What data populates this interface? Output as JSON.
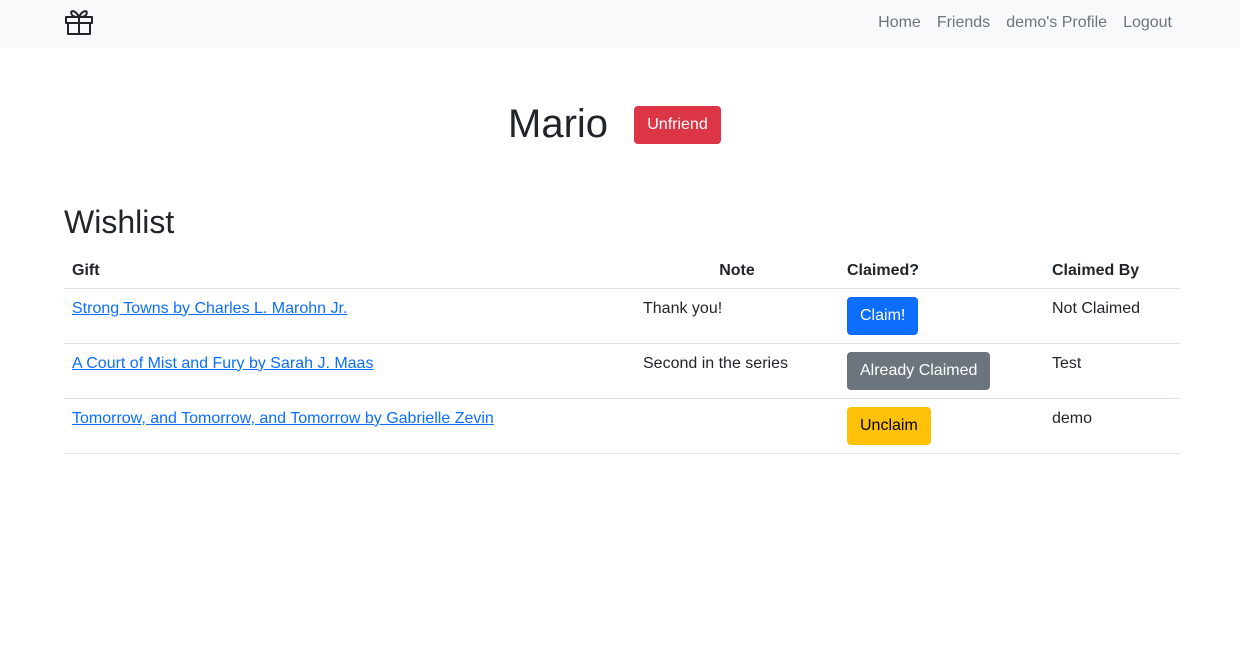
{
  "navbar": {
    "brand_icon": "gift-icon",
    "links": [
      "Home",
      "Friends",
      "demo's Profile",
      "Logout"
    ]
  },
  "profile": {
    "name": "Mario",
    "unfriend_label": "Unfriend"
  },
  "wishlist": {
    "title": "Wishlist",
    "columns": [
      "Gift",
      "Note",
      "Claimed?",
      "Claimed By"
    ],
    "rows": [
      {
        "gift": "Strong Towns by Charles L. Marohn Jr.",
        "note": "Thank you!",
        "action": "Claim!",
        "claimed_by": "Not Claimed"
      },
      {
        "gift": "A Court of Mist and Fury by Sarah J. Maas",
        "note": "Second in the series",
        "action": "Already Claimed",
        "claimed_by": "Test"
      },
      {
        "gift": "Tomorrow, and Tomorrow, and Tomorrow by Gabrielle Zevin",
        "note": "",
        "action": "Unclaim",
        "claimed_by": "demo"
      }
    ]
  },
  "colors": {
    "navbar_bg": "#f8f9fa",
    "danger": "#dc3545",
    "primary": "#0d6efd",
    "secondary": "#6c757d",
    "warning": "#ffc107",
    "link": "#0d6efd"
  }
}
